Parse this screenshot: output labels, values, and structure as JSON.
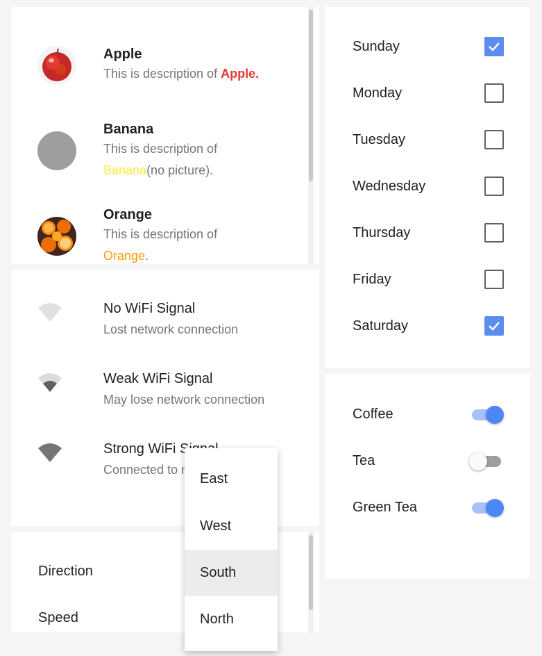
{
  "fruits": [
    {
      "title": "Apple",
      "desc_prefix": "This is description of ",
      "name": "Apple.",
      "desc_suffix": "",
      "name_color": "#e53935",
      "has_picture": true
    },
    {
      "title": "Banana",
      "desc_prefix": "This is description of ",
      "name": "Banana",
      "desc_suffix": "(no picture).",
      "name_color": "#ffeb3b",
      "has_picture": false
    },
    {
      "title": "Orange",
      "desc_prefix": "This is description of ",
      "name": "Orange",
      "desc_suffix": ".",
      "name_color": "#ff9800",
      "has_picture": true
    }
  ],
  "wifi": [
    {
      "title": "No WiFi Signal",
      "subtitle": "Lost network connection",
      "icon": "wifi-none-icon"
    },
    {
      "title": "Weak WiFi Signal",
      "subtitle": "May lose network connection",
      "icon": "wifi-weak-icon"
    },
    {
      "title": "Strong WiFi Signal",
      "subtitle": "Connected to network",
      "icon": "wifi-strong-icon"
    }
  ],
  "settings": {
    "direction_label": "Direction",
    "speed_label": "Speed"
  },
  "days": [
    {
      "label": "Sunday",
      "checked": true
    },
    {
      "label": "Monday",
      "checked": false
    },
    {
      "label": "Tuesday",
      "checked": false
    },
    {
      "label": "Wednesday",
      "checked": false
    },
    {
      "label": "Thursday",
      "checked": false
    },
    {
      "label": "Friday",
      "checked": false
    },
    {
      "label": "Saturday",
      "checked": true
    }
  ],
  "drinks": [
    {
      "label": "Coffee",
      "on": true
    },
    {
      "label": "Tea",
      "on": false
    },
    {
      "label": "Green Tea",
      "on": true
    }
  ],
  "direction_menu": {
    "options": [
      "East",
      "West",
      "South",
      "North"
    ],
    "selected": "South"
  },
  "colors": {
    "accent": "#5b8def",
    "toggle_on": "#4f86f7"
  }
}
